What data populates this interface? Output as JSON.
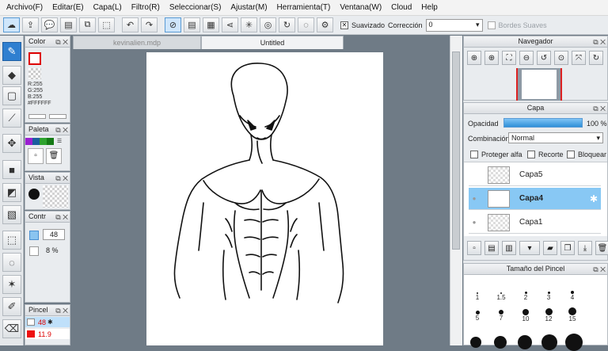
{
  "menu": [
    "Archivo(F)",
    "Editar(E)",
    "Capa(L)",
    "Filtro(R)",
    "Seleccionar(S)",
    "Ajustar(M)",
    "Herramienta(T)",
    "Ventana(W)",
    "Cloud",
    "Help"
  ],
  "toolbar": {
    "suavizado_label": "Suavizado",
    "correccion_label": "Corrección",
    "correccion_value": "0",
    "bordes_label": "Bordes Suaves"
  },
  "tabs": [
    "kevinalien.mdp",
    "Untitled"
  ],
  "color_panel": {
    "title": "Color",
    "r": "R:255",
    "g": "G:255",
    "b": "B:255",
    "hex": "#FFFFFF"
  },
  "paleta_panel": {
    "title": "Paleta",
    "colors": [
      "#9b1fd1",
      "#1b5e9e",
      "#2ea32e",
      "#157a15"
    ]
  },
  "vista_panel": {
    "title": "Vista"
  },
  "control_panel": {
    "title": "Contr",
    "size": "48",
    "opacity": "8 %"
  },
  "pincel_panel": {
    "title": "Pincel",
    "items": [
      "48",
      "11.9"
    ]
  },
  "navegador": {
    "title": "Navegador"
  },
  "capa": {
    "title": "Capa",
    "opacity_label": "Opacidad",
    "opacity_value": "100 %",
    "opacity_fraction": 1.0,
    "blend_label": "Combinación",
    "blend_value": "Normal",
    "proteger": "Proteger alfa",
    "recorte": "Recorte",
    "bloquear": "Bloquear",
    "layers": [
      {
        "name": "Capa5",
        "selected": false
      },
      {
        "name": "Capa4",
        "selected": true
      },
      {
        "name": "Capa1",
        "selected": false
      }
    ]
  },
  "brush_size": {
    "title": "Tamaño del Pincel",
    "row1": [
      "1",
      "1.5",
      "2",
      "3",
      "4"
    ],
    "row2": [
      "5",
      "7",
      "10",
      "12",
      "15"
    ]
  },
  "accent_color": "#2f7fd0"
}
